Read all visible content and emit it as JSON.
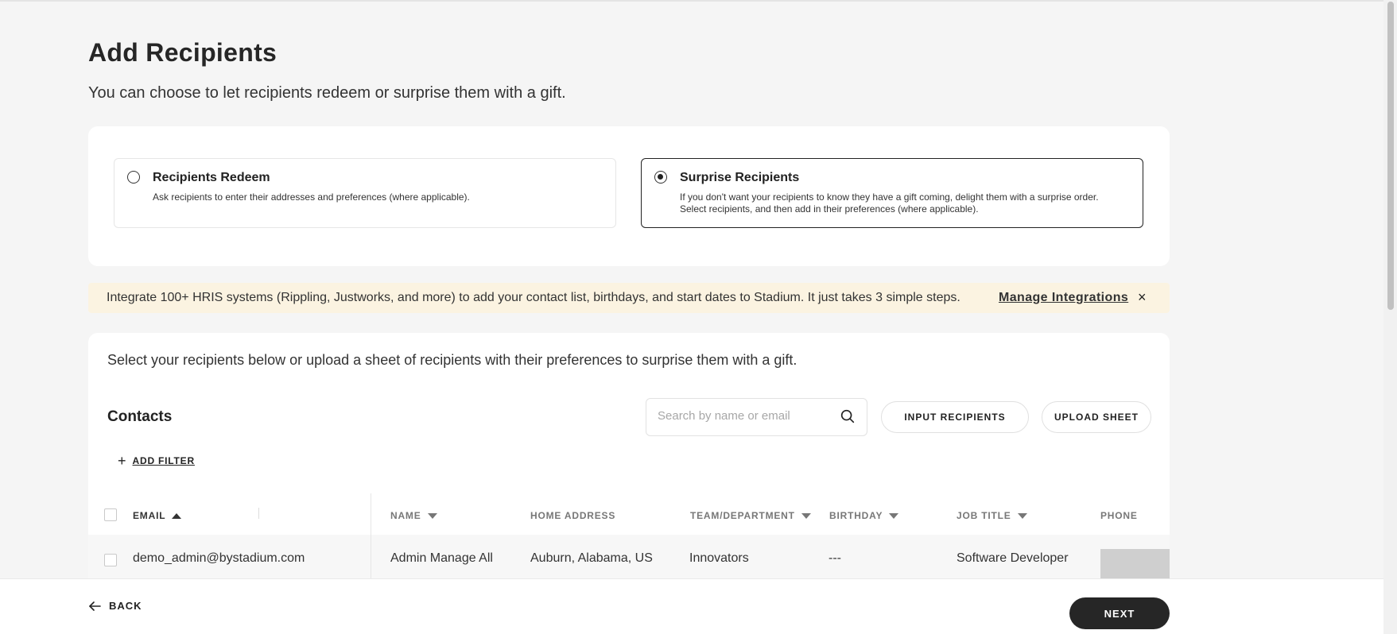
{
  "page": {
    "title": "Add Recipients",
    "subtitle": "You can choose to let recipients redeem or surprise them with a gift."
  },
  "options": {
    "redeem": {
      "title": "Recipients Redeem",
      "description": "Ask recipients to enter their addresses and preferences (where applicable).",
      "selected": false
    },
    "surprise": {
      "title": "Surprise Recipients",
      "description_line1": "If you don't want your recipients to know they have a gift coming, delight them with a surprise order.",
      "description_line2": "Select recipients, and then add in their preferences (where applicable).",
      "selected": true
    }
  },
  "banner": {
    "text": "Integrate 100+ HRIS systems (Rippling, Justworks, and more) to add your contact list, birthdays, and start dates to Stadium. It just takes 3 simple steps.",
    "link": "Manage Integrations",
    "close": "×"
  },
  "recipients": {
    "intro": "Select your recipients below or upload a sheet of recipients with their preferences to surprise them with a gift.",
    "contacts_title": "Contacts",
    "search_placeholder": "Search by name or email",
    "input_button": "INPUT RECIPIENTS",
    "upload_button": "UPLOAD SHEET",
    "add_filter": "ADD FILTER"
  },
  "table": {
    "columns": {
      "email": "EMAIL",
      "name": "NAME",
      "home_address": "HOME ADDRESS",
      "team": "TEAM/DEPARTMENT",
      "birthday": "BIRTHDAY",
      "job_title": "JOB TITLE",
      "phone": "PHONE"
    },
    "rows": [
      {
        "email": "demo_admin@bystadium.com",
        "name": "Admin Manage All",
        "home_address": "Auburn, Alabama, US",
        "team": "Innovators",
        "birthday": "---",
        "job_title": "Software Developer"
      }
    ]
  },
  "footer": {
    "back": "BACK",
    "next": "NEXT"
  }
}
